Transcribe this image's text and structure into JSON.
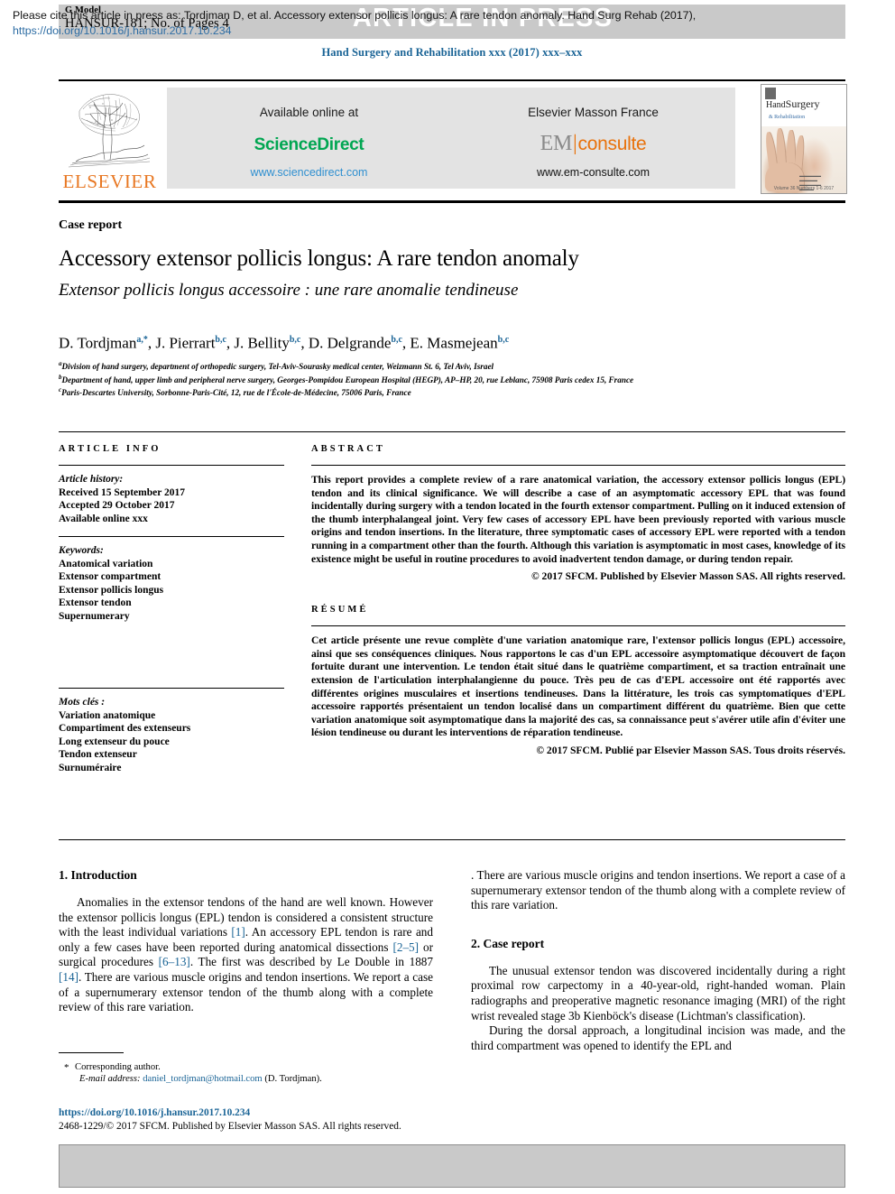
{
  "banner": {
    "g_model": "G Model",
    "article_id": "HANSUR-181; No. of Pages 4",
    "article_in_press": "ARTICLE IN PRESS"
  },
  "journal": {
    "header_line": "Hand Surgery and Rehabilitation xxx (2017) xxx–xxx"
  },
  "masthead": {
    "publisher_name": "ELSEVIER",
    "available_online_label": "Available online at",
    "sciencedirect_logo": "ScienceDirect",
    "sciencedirect_url": "www.sciencedirect.com",
    "elsevier_masson_label": "Elsevier Masson France",
    "em_logo_em": "EM",
    "em_logo_consulte": "consulte",
    "em_url": "www.em-consulte.com",
    "cover": {
      "title_hand": "Hand",
      "title_surgery": "Surgery",
      "title_amp": "&",
      "title_rehab": "Rehabilitation",
      "footer": "Volume 36\nNumbers 1-6  2017"
    }
  },
  "article": {
    "type_label": "Case report",
    "title_en": "Accessory extensor pollicis longus: A rare tendon anomaly",
    "title_fr": "Extensor pollicis longus accessoire : une rare anomalie tendineuse",
    "authors": [
      {
        "name": "D. Tordjman",
        "sup": "a,*"
      },
      {
        "name": "J. Pierrart",
        "sup": "b,c"
      },
      {
        "name": "J. Bellity",
        "sup": "b,c"
      },
      {
        "name": "D. Delgrande",
        "sup": "b,c"
      },
      {
        "name": "E. Masmejean",
        "sup": "b,c"
      }
    ],
    "affiliations": [
      {
        "marker": "a",
        "text": "Division of hand surgery, department of orthopedic surgery, Tel-Aviv-Sourasky medical center, Weizmann St. 6, Tel Aviv, Israel"
      },
      {
        "marker": "b",
        "text": "Department of hand, upper limb and peripheral nerve surgery, Georges-Pompidou European Hospital (HEGP), AP–HP, 20, rue Leblanc, 75908 Paris cedex 15, France"
      },
      {
        "marker": "c",
        "text": "Paris-Descartes University, Sorbonne-Paris-Cité, 12, rue de l'École-de-Médecine, 75006 Paris, France"
      }
    ]
  },
  "article_info": {
    "heading": "ARTICLE INFO",
    "history_label": "Article history:",
    "history": [
      "Received 15 September 2017",
      "Accepted 29 October 2017",
      "Available online xxx"
    ],
    "keywords_label": "Keywords:",
    "keywords": [
      "Anatomical variation",
      "Extensor compartment",
      "Extensor pollicis longus",
      "Extensor tendon",
      "Supernumerary"
    ],
    "motscles_label": "Mots clés :",
    "motscles": [
      "Variation anatomique",
      "Compartiment des extenseurs",
      "Long extenseur du pouce",
      "Tendon extenseur",
      "Surnuméraire"
    ]
  },
  "abstract": {
    "heading": "ABSTRACT",
    "text": "This report provides a complete review of a rare anatomical variation, the accessory extensor pollicis longus (EPL) tendon and its clinical significance. We will describe a case of an asymptomatic accessory EPL that was found incidentally during surgery with a tendon located in the fourth extensor compartment. Pulling on it induced extension of the thumb interphalangeal joint. Very few cases of accessory EPL have been previously reported with various muscle origins and tendon insertions. In the literature, three symptomatic cases of accessory EPL were reported with a tendon running in a compartment other than the fourth. Although this variation is asymptomatic in most cases, knowledge of its existence might be useful in routine procedures to avoid inadvertent tendon damage, or during tendon repair.",
    "copyright": "© 2017 SFCM. Published by Elsevier Masson SAS. All rights reserved."
  },
  "resume": {
    "heading": "RÉSUMÉ",
    "text": "Cet article présente une revue complète d'une variation anatomique rare, l'extensor pollicis longus (EPL) accessoire, ainsi que ses conséquences cliniques. Nous rapportons le cas d'un EPL accessoire asymptomatique découvert de façon fortuite durant une intervention. Le tendon était situé dans le quatrième compartiment, et sa traction entraînait une extension de l'articulation interphalangienne du pouce. Très peu de cas d'EPL accessoire ont été rapportés avec différentes origines musculaires et insertions tendineuses. Dans la littérature, les trois cas symptomatiques d'EPL accessoire rapportés présentaient un tendon localisé dans un compartiment différent du quatrième. Bien que cette variation anatomique soit asymptomatique dans la majorité des cas, sa connaissance peut s'avérer utile afin d'éviter une lésion tendineuse ou durant les interventions de réparation tendineuse.",
    "copyright": "© 2017 SFCM. Publié par Elsevier Masson SAS. Tous droits réservés."
  },
  "body": {
    "section1_heading": "1. Introduction",
    "section1_para1_a": "Anomalies in the extensor tendons of the hand are well known. However the extensor pollicis longus (EPL) tendon is considered a consistent structure with the least individual variations ",
    "section1_ref1": "[1]",
    "section1_para1_b": ". An accessory EPL tendon is rare and only a few cases have been reported during anatomical dissections ",
    "section1_ref2": "[2–5]",
    "section1_para1_c": " or surgical procedures ",
    "section1_ref3": "[6–13]",
    "section1_para1_d": ". The first was described by Le Double in 1887 ",
    "section1_ref4": "[14]",
    "section1_para1_e": ". There are various muscle origins and tendon insertions. We report a case of a supernumerary extensor tendon of the thumb along with a complete review of this rare variation.",
    "section2_heading": "2. Case report",
    "section2_para1": "The unusual extensor tendon was discovered incidentally during a right proximal row carpectomy in a 40-year-old, right-handed woman. Plain radiographs and preoperative magnetic resonance imaging (MRI) of the right wrist revealed stage 3b Kienböck's disease (Lichtman's classification).",
    "section2_para2": "During the dorsal approach, a longitudinal incision was made, and the third compartment was opened to identify the EPL and"
  },
  "footnote": {
    "corresponding_author": "Corresponding author.",
    "email_label": "E-mail address:",
    "email": "daniel_tordjman@hotmail.com",
    "email_owner": "(D. Tordjman).",
    "doi": "https://doi.org/10.1016/j.hansur.2017.10.234",
    "issn_line": "2468-1229/© 2017 SFCM. Published by Elsevier Masson SAS. All rights reserved."
  },
  "citation_box": {
    "text": "Please cite this article in press as: Tordjman D, et al. Accessory extensor pollicis longus: A rare tendon anomaly. Hand Surg Rehab (2017),",
    "doi": "https://doi.org/10.1016/j.hansur.2017.10.234"
  },
  "colors": {
    "link_blue": "#1a6496",
    "elsevier_orange": "#e87722",
    "sciencedirect_green": "#00a651",
    "em_orange": "#e8720c",
    "banner_grey": "#c9c9c9"
  }
}
